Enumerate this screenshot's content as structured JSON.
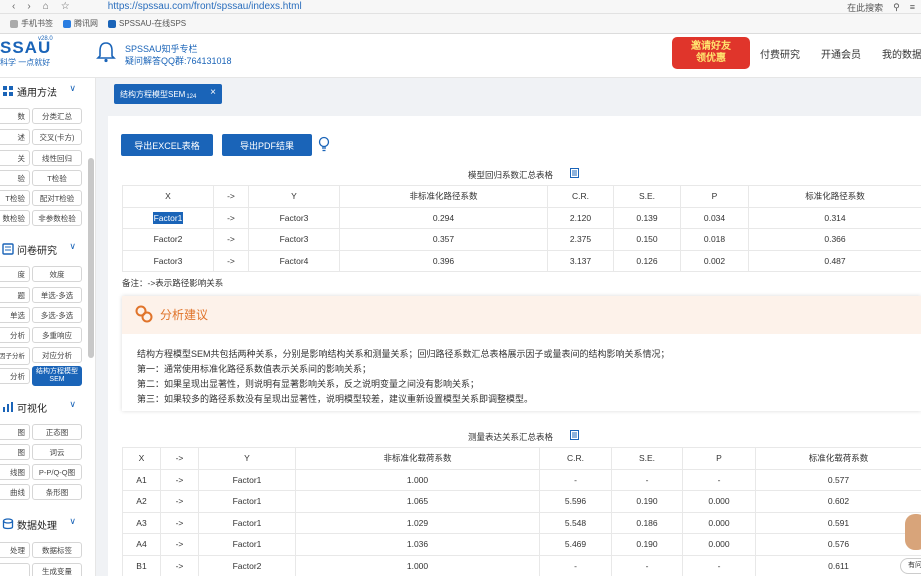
{
  "browser": {
    "url": "https://spssau.com/front/spssau/indexs.html",
    "search_text": "在此搜索",
    "bookmarks": [
      "手机书签",
      "腾讯网",
      "SPSSAU-在线SPS"
    ]
  },
  "header": {
    "logo_text": "SSAU",
    "logo_version": "v28.0",
    "slogan": "科学 一点就好",
    "zhihu_line1": "SPSSAU知乎专栏",
    "zhihu_line2": "疑问解答QQ群:764131018",
    "invite_line1": "邀请好友",
    "invite_line2": "领优惠",
    "nav": [
      "付费研究",
      "开通会员",
      "我的数据"
    ]
  },
  "sidebar": {
    "sections": [
      {
        "title": "通用方法",
        "chips": [
          "数",
          "分类汇总",
          "述",
          "交叉(卡方)",
          "关",
          "线性回归",
          "验",
          "T检验",
          "T检验",
          "配对T检验",
          "数检验",
          "非参数检验"
        ]
      },
      {
        "title": "问卷研究",
        "chips": [
          "度",
          "效度",
          "题",
          "单选-多选",
          "单选",
          "多选-多选",
          "分析",
          "多重响应",
          "探索因子分析",
          "对应分析",
          "分析",
          "结构方程模型SEM"
        ]
      },
      {
        "title": "可视化",
        "chips": [
          "图",
          "正态图",
          "图",
          "词云",
          "线图",
          "P-P/Q-Q图",
          "曲线",
          "条形图"
        ]
      },
      {
        "title": "数据处理",
        "chips": [
          "处理",
          "数据标签",
          "",
          "生成变量"
        ]
      }
    ]
  },
  "tab": {
    "label": "结构方程模型SEM",
    "sub": "124",
    "close": "×"
  },
  "buttons": {
    "export_excel": "导出EXCEL表格",
    "export_pdf": "导出PDF结果"
  },
  "table1": {
    "title": "模型回归系数汇总表格",
    "headers": [
      "X",
      "->",
      "Y",
      "非标准化路径系数",
      "C.R.",
      "S.E.",
      "P",
      "标准化路径系数"
    ],
    "rows": [
      [
        "Factor1",
        "->",
        "Factor3",
        "0.294",
        "2.120",
        "0.139",
        "0.034",
        "0.314"
      ],
      [
        "Factor2",
        "->",
        "Factor3",
        "0.357",
        "2.375",
        "0.150",
        "0.018",
        "0.366"
      ],
      [
        "Factor3",
        "->",
        "Factor4",
        "0.396",
        "3.137",
        "0.126",
        "0.002",
        "0.487"
      ]
    ],
    "note": "备注：->表示路径影响关系"
  },
  "advice": {
    "title": "分析建议",
    "lines": [
      "结构方程模型SEM共包括两种关系，分别是影响结构关系和测量关系；回归路径系数汇总表格展示因子或量表间的结构影响关系情况；",
      "第一：通常使用标准化路径系数值表示关系间的影响关系；",
      "第二：如果呈现出显著性，则说明有显著影响关系，反之说明变量之间没有影响关系；",
      "第三：如果较多的路径系数没有呈现出显著性，说明模型较差，建议重新设置模型关系即调整模型。"
    ]
  },
  "table2": {
    "title": "测量表达关系汇总表格",
    "headers": [
      "X",
      "->",
      "Y",
      "非标准化载荷系数",
      "C.R.",
      "S.E.",
      "P",
      "标准化载荷系数"
    ],
    "rows": [
      [
        "A1",
        "->",
        "Factor1",
        "1.000",
        "-",
        "-",
        "-",
        "0.577"
      ],
      [
        "A2",
        "->",
        "Factor1",
        "1.065",
        "5.596",
        "0.190",
        "0.000",
        "0.602"
      ],
      [
        "A3",
        "->",
        "Factor1",
        "1.029",
        "5.548",
        "0.186",
        "0.000",
        "0.591"
      ],
      [
        "A4",
        "->",
        "Factor1",
        "1.036",
        "5.469",
        "0.190",
        "0.000",
        "0.576"
      ],
      [
        "B1",
        "->",
        "Factor2",
        "1.000",
        "-",
        "-",
        "-",
        "0.611"
      ]
    ]
  },
  "help": "有问"
}
